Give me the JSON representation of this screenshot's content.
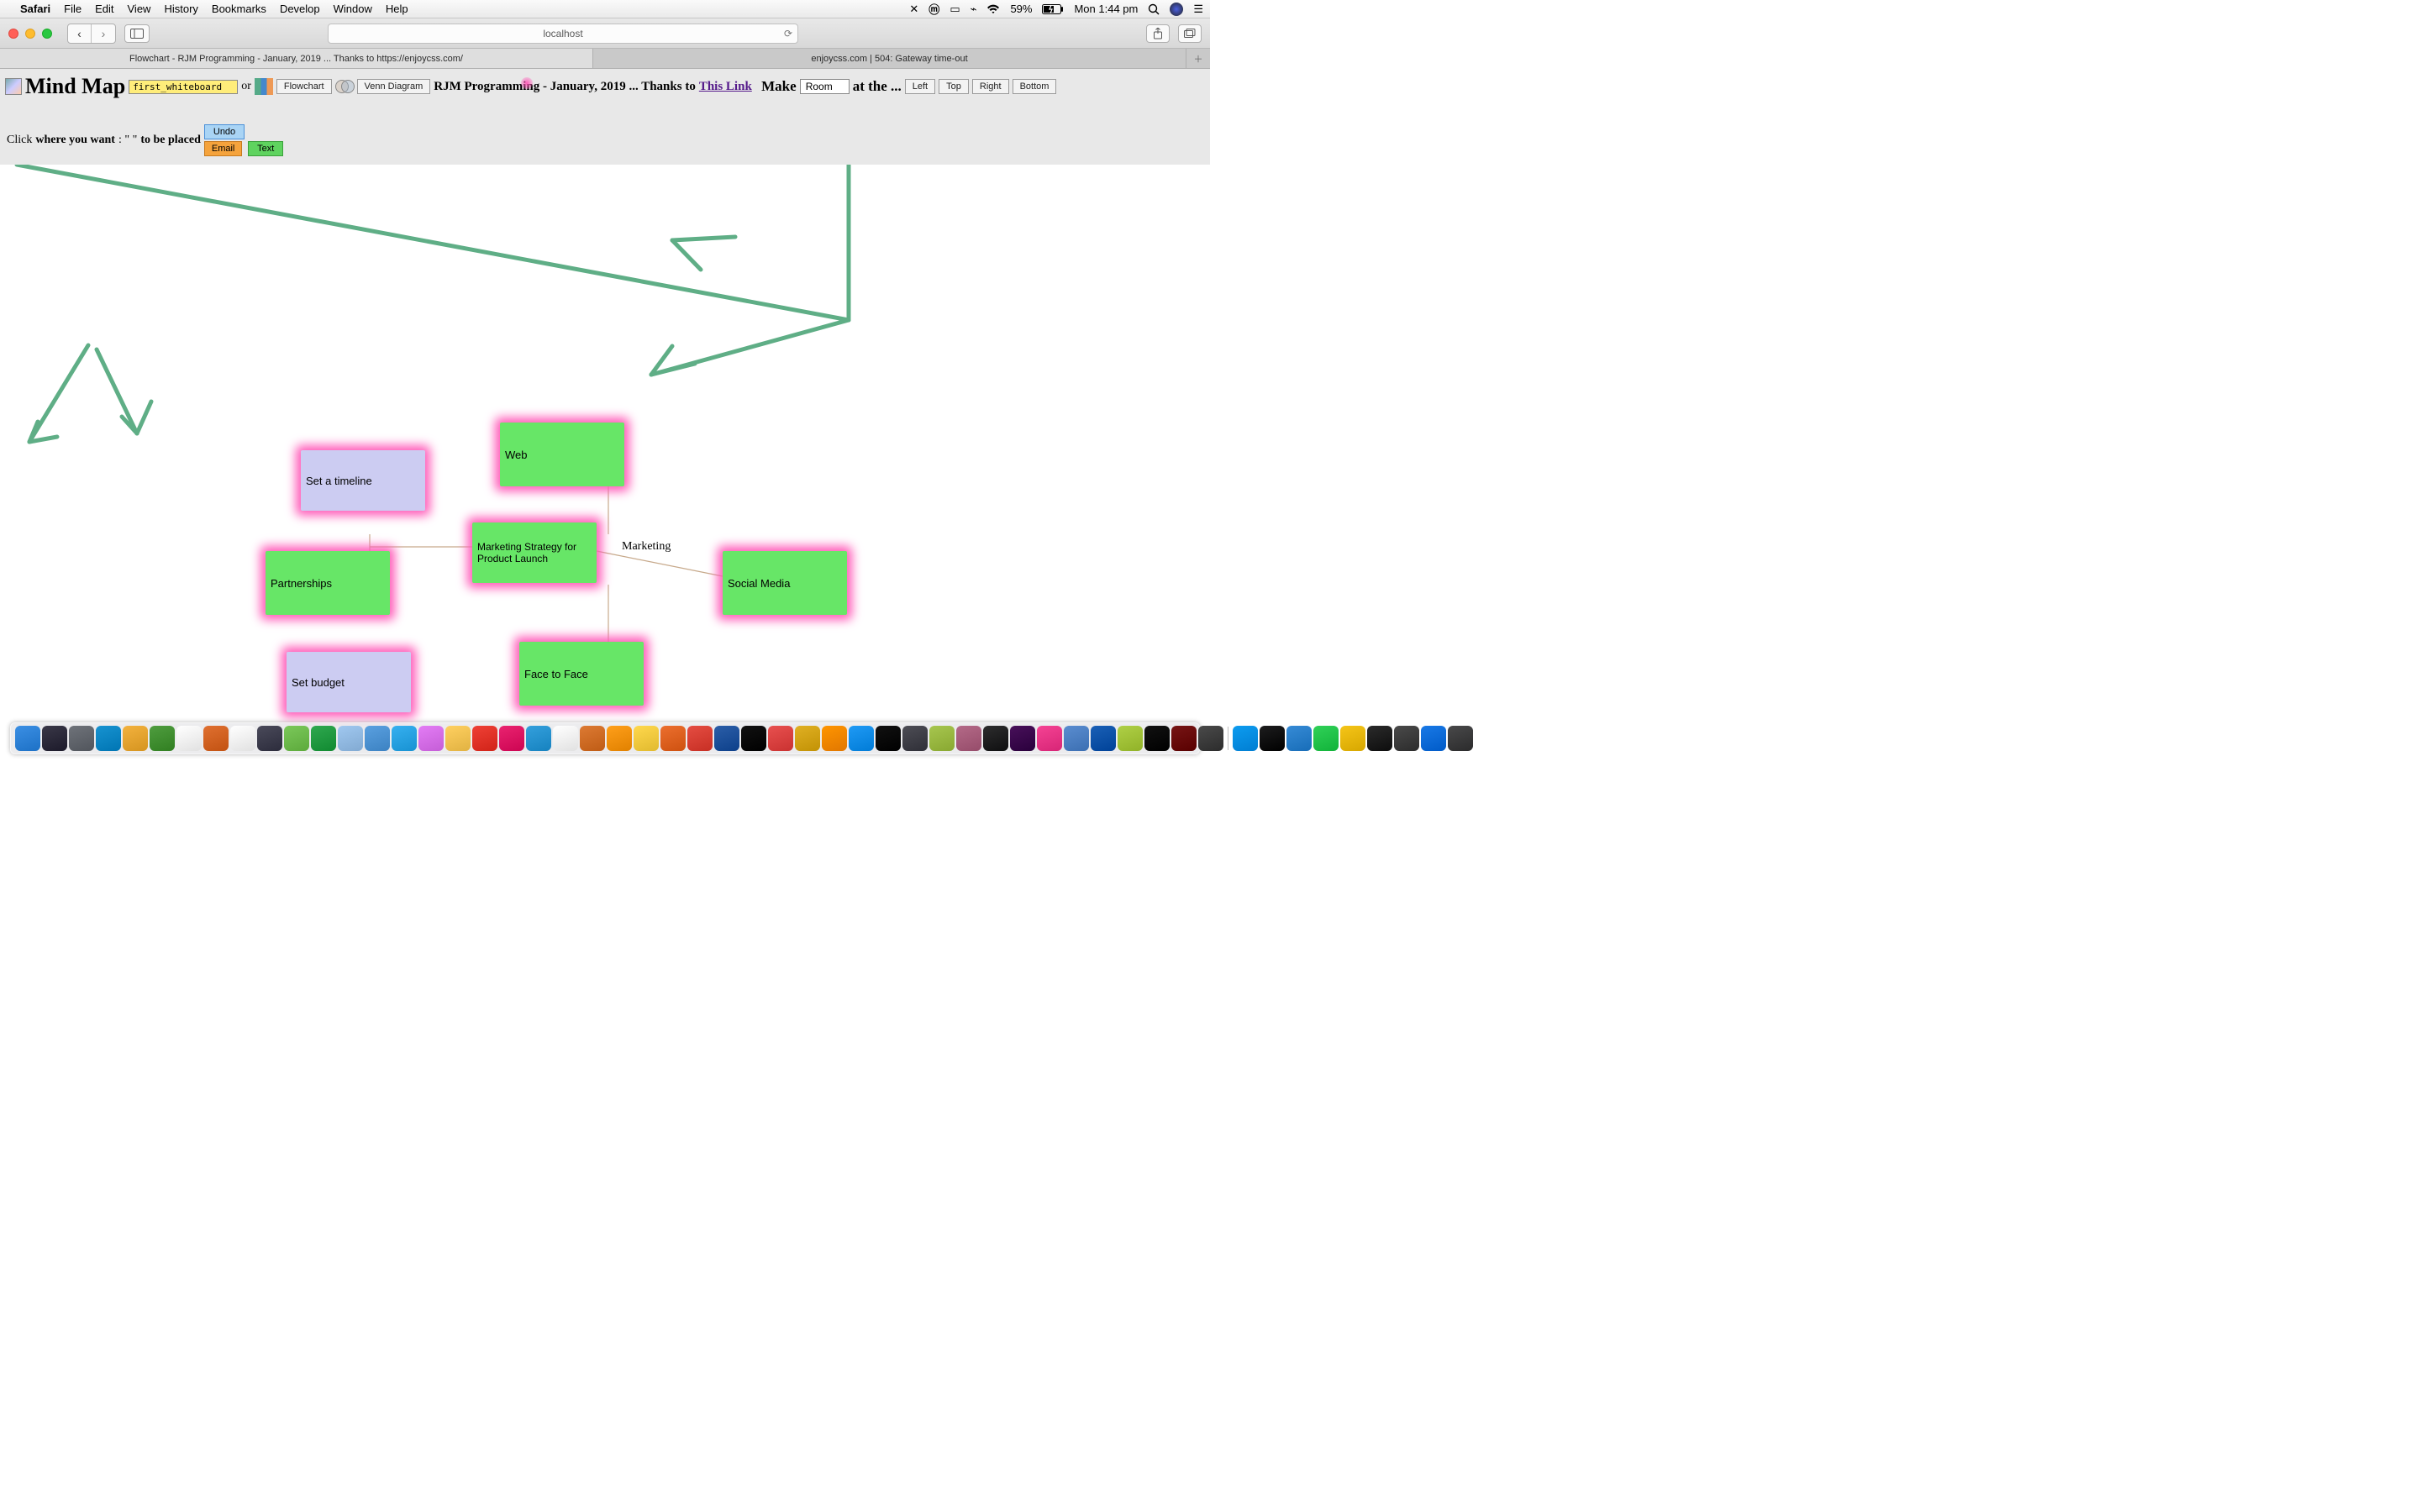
{
  "menubar": {
    "app": "Safari",
    "items": [
      "File",
      "Edit",
      "View",
      "History",
      "Bookmarks",
      "Develop",
      "Window",
      "Help"
    ],
    "battery": "59%",
    "clock": "Mon 1:44 pm"
  },
  "safari": {
    "url": "localhost",
    "tabs": [
      "Flowchart - RJM Programming - January, 2019 ... Thanks to https://enjoycss.com/",
      "enjoycss.com | 504: Gateway time-out"
    ]
  },
  "header": {
    "title": "Mind Map",
    "select1": "first_whiteboard",
    "or": "or",
    "flowchart_btn": "Flowchart",
    "venn_btn": "Venn Diagram",
    "mid_text": "RJM Programming - January, 2019 ... Thanks to",
    "link_text": "This Link",
    "make": "Make",
    "room_select": "Room",
    "at_the": "at the ...",
    "dir_btns": [
      "Left",
      "Top",
      "Right",
      "Bottom"
    ]
  },
  "row2": {
    "click": "Click",
    "where": "where you want",
    "dq": "\" \"",
    "placed": "to be placed",
    "undo": "Undo",
    "email": "Email",
    "text": "Text"
  },
  "nodes": {
    "timeline": "Set a timeline",
    "web": "Web",
    "partnerships": "Partnerships",
    "strategy": "Marketing Strategy for Product Launch",
    "social": "Social Media",
    "budget": "Set budget",
    "face": "Face to Face",
    "marketing_label": "Marketing"
  },
  "dock_colors": [
    "#3b8fe4",
    "#3a3848",
    "#6f737a",
    "#1793d1",
    "#f3b23e",
    "#4f9d3f",
    "#ffffff",
    "#e07030",
    "#ffffff",
    "#4a4a5a",
    "#7bc85a",
    "#2fa84f",
    "#a0c8f0",
    "#5aa0e0",
    "#36b0f0",
    "#e37cf5",
    "#ffd060",
    "#ef4136",
    "#ea2370",
    "#34a0dd",
    "#ffffff",
    "#dd7a33",
    "#ff9f1a",
    "#ffd84d",
    "#ec6f2e",
    "#e54d42",
    "#2b5ea8",
    "#111111",
    "#e8504f",
    "#e0b023",
    "#ff9500",
    "#1f9af5",
    "#111111",
    "#4d4d55",
    "#a7c64f",
    "#b46a88",
    "#2d2d2e",
    "#48105a",
    "#f54394",
    "#5a8dd0",
    "#1a60b6",
    "#afd046",
    "#111111",
    "#771515",
    "#4a4a4a",
    "#0d9cf0",
    "#1d1d1e",
    "#368bd6",
    "#30d158",
    "#f5c518",
    "#2b2b2b",
    "#4a4a4a",
    "#1979e6",
    "#49494a"
  ]
}
